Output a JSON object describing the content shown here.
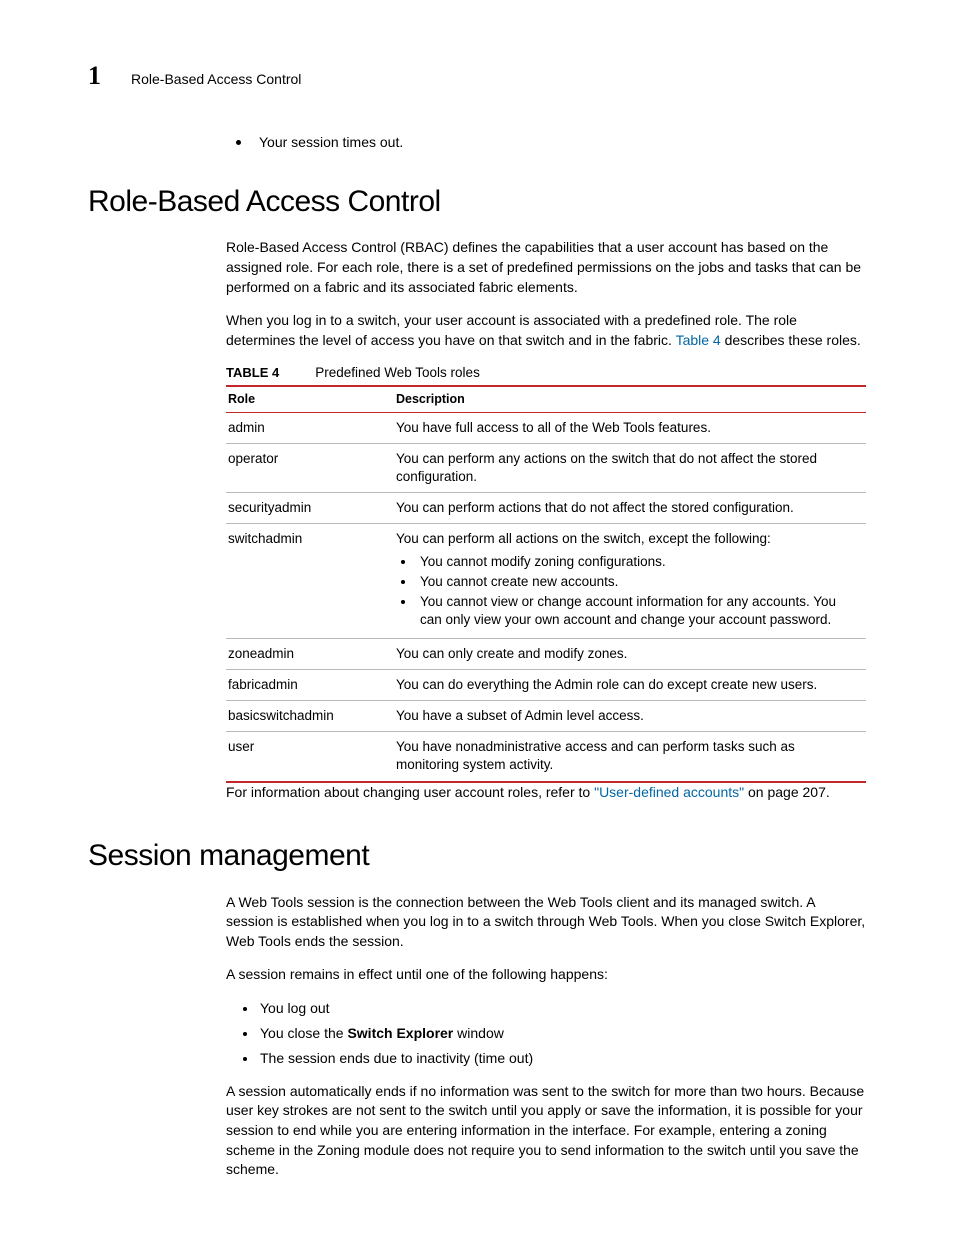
{
  "header": {
    "chapter_number": "1",
    "chapter_title": "Role-Based Access Control"
  },
  "top_bullet": "Your session times out.",
  "section_rbac": {
    "heading": "Role-Based Access Control",
    "para1": "Role-Based Access Control (RBAC) defines the capabilities that a user account has based on the assigned role. For each role, there is a set of predefined permissions on the jobs and tasks that can be performed on a fabric and its associated fabric elements.",
    "para2_a": "When you log in to a switch, your user account is associated with a predefined role. The role determines the level of access you have on that switch and in the fabric. ",
    "para2_link": "Table 4",
    "para2_b": " describes these roles.",
    "table_label": "TABLE 4",
    "table_title": "Predefined Web Tools roles",
    "th_role": "Role",
    "th_desc": "Description",
    "rows": [
      {
        "role": "admin",
        "desc": "You have full access to all of the Web Tools features."
      },
      {
        "role": "operator",
        "desc": "You can perform any actions on the switch that do not affect the stored configuration."
      },
      {
        "role": "securityadmin",
        "desc": "You can perform actions that do not affect the stored configuration."
      },
      {
        "role": "switchadmin",
        "desc": "You can perform all actions on the switch, except the following:",
        "sub": [
          "You cannot modify zoning configurations.",
          "You cannot create new accounts.",
          "You cannot view or change account information for any accounts. You can only view your own account and change your account password."
        ]
      },
      {
        "role": "zoneadmin",
        "desc": "You can only create and modify zones."
      },
      {
        "role": "fabricadmin",
        "desc": "You can do everything the Admin role can do except create new users."
      },
      {
        "role": "basicswitchadmin",
        "desc": "You have a subset of Admin level access."
      },
      {
        "role": "user",
        "desc": "You have nonadministrative access and can perform tasks such as monitoring system activity."
      }
    ],
    "after_a": "For information about changing user account roles, refer to ",
    "after_link": "\"User-defined accounts\"",
    "after_b": " on page 207."
  },
  "section_session": {
    "heading": "Session management",
    "para1": "A Web Tools session is the connection between the Web Tools client and its managed switch. A session is established when you log in to a switch through Web Tools. When you close Switch Explorer, Web Tools ends the session.",
    "para2": "A session remains in effect until one of the following happens:",
    "bullets": {
      "b1": "You log out",
      "b2a": "You close the ",
      "b2bold": "Switch Explorer",
      "b2b": " window",
      "b3": "The session ends due to inactivity (time out)"
    },
    "para3": "A session automatically ends if no information was sent to the switch for more than two hours. Because user key strokes are not sent to the switch until you apply or save the information, it is possible for your session to end while you are entering information in the interface. For example, entering a zoning scheme in the Zoning module does not require you to send information to the switch until you save the scheme."
  }
}
